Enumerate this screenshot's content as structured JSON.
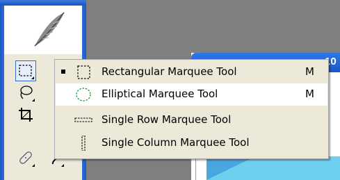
{
  "document": {
    "title": "10"
  },
  "toolbox": {
    "tools": [
      {
        "name": "rectangular-marquee",
        "selected": true
      },
      {
        "name": "lasso",
        "selected": false
      },
      {
        "name": "crop",
        "selected": false
      },
      {
        "name": "healing-brush",
        "selected": false
      }
    ]
  },
  "flyout": {
    "items": [
      {
        "label": "Rectangular Marquee Tool",
        "shortcut": "M",
        "icon": "rectangular-marquee-icon",
        "current": true,
        "hover": false
      },
      {
        "label": "Elliptical Marquee Tool",
        "shortcut": "M",
        "icon": "elliptical-marquee-icon",
        "current": false,
        "hover": true
      },
      {
        "label": "Single Row Marquee Tool",
        "shortcut": "",
        "icon": "single-row-marquee-icon",
        "current": false,
        "hover": false
      },
      {
        "label": "Single Column Marquee Tool",
        "shortcut": "",
        "icon": "single-column-marquee-icon",
        "current": false,
        "hover": false
      }
    ]
  },
  "colors": {
    "toolbox_frame": "#1d55c4",
    "menu_bg": "#ece9d8",
    "hover_bg": "#ffffff",
    "canvas": "#6ed0ee"
  }
}
